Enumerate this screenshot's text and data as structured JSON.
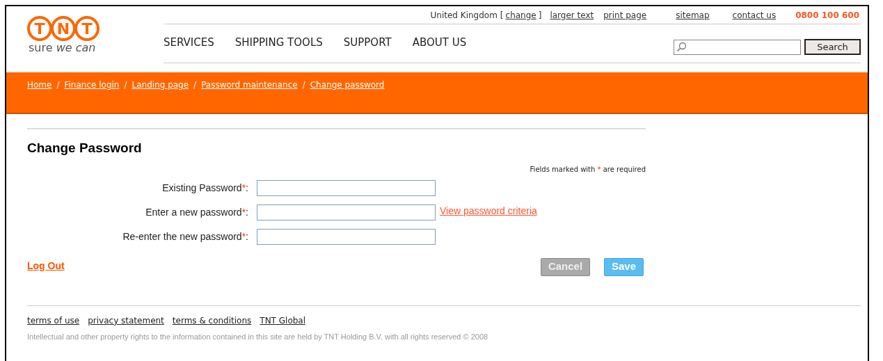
{
  "logo": {
    "letters": [
      "T",
      "N",
      "T"
    ],
    "tagline": "sure *we can*"
  },
  "utility_bar": {
    "country": "United Kingdom",
    "bracket_open": "[",
    "change_link": "change",
    "bracket_close": "]",
    "links": [
      "larger text",
      "print page",
      "sitemap",
      "contact us"
    ],
    "phone": "0800 100 600"
  },
  "nav": [
    "SERVICES",
    "SHIPPING TOOLS",
    "SUPPORT",
    "ABOUT US"
  ],
  "search": {
    "button": "Search"
  },
  "breadcrumb": {
    "items": [
      "Home",
      "Finance login",
      "Landing page",
      "Password maintenance",
      "Change password"
    ],
    "separator": "/"
  },
  "form": {
    "title": "Change Password",
    "required_note": {
      "before": "Fields marked with",
      "mark": "*",
      "after": "are required"
    },
    "fields": [
      {
        "label": "Existing Password",
        "mark": "*",
        "end": ":"
      },
      {
        "label": "Enter a new password",
        "mark": "*",
        "end": ":",
        "link": "View password criteria"
      },
      {
        "label": "Re-enter the new password",
        "mark": "*",
        "end": ":"
      }
    ],
    "logout": "Log Out",
    "buttons": [
      {
        "kind": "cancel",
        "label": "Cancel"
      },
      {
        "kind": "save",
        "label": "Save"
      }
    ]
  },
  "footer": {
    "links": [
      "terms of use",
      "privacy statement",
      "terms & conditions",
      "TNT Global"
    ],
    "copyright": "Intellectual and other property rights to the information contained in this site are held by TNT Holding B.V. with all rights reserved © 2008"
  }
}
